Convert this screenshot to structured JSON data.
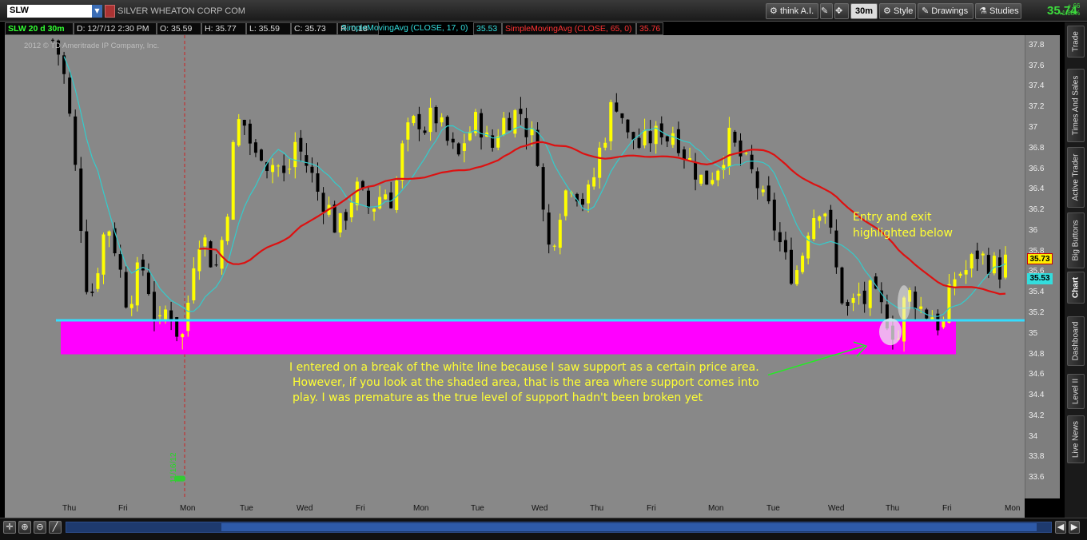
{
  "toolbar": {
    "symbol": "SLW",
    "company": "SILVER WHEATON CORP COM",
    "think_ai": "think A.I.",
    "interval": "30m",
    "style_label": "Style",
    "drawings_label": "Drawings",
    "studies_label": "Studies",
    "last_price": "35.74",
    "change": "+.66",
    "change_pct": "+1.88%"
  },
  "infobar": {
    "title": "SLW 20 d 30m",
    "date": "D: 12/7/12 2:30 PM",
    "open": "O: 35.59",
    "high": "H: 35.77",
    "low": "L: 35.59",
    "close": "C: 35.73",
    "range": "R: 0.18",
    "sma17_label": "SimpleMovingAvg (CLOSE, 17, 0)",
    "sma17_value": "35.53",
    "sma65_label": "SimpleMovingAvg (CLOSE, 65, 0)",
    "sma65_value": "35.76"
  },
  "chart": {
    "copyright": "2012 © TD Ameritrade IP Company, Inc.",
    "marker_label": "11/16/12",
    "annotation_entry": [
      "Entry and exit",
      "highlighted below"
    ],
    "annotation_main": [
      "I entered on a break of the white line because I saw support as a certain price area.",
      "However, if you look at the shaded area, that is the area where support comes into",
      "play. I was premature as the true level of support hadn't been broken yet"
    ],
    "price_tag_close": "35.73",
    "price_tag_sma": "35.53",
    "colors": {
      "background": "#888888",
      "bull_candle": "#ffff00",
      "bear_candle": "#000000",
      "sma17": "#33cccc",
      "sma65": "#dd1111",
      "support_line": "#33ddff",
      "shaded_zone": "#ff00ff",
      "annotation_text": "#ffff33"
    }
  },
  "chart_data": {
    "type": "candlestick",
    "title": "SLW 20 d 30m",
    "ylim": [
      33.4,
      37.9
    ],
    "y_ticks": [
      33.6,
      33.8,
      34,
      34.2,
      34.4,
      34.6,
      34.8,
      35,
      35.2,
      35.4,
      35.6,
      35.8,
      36,
      36.2,
      36.4,
      36.6,
      36.8,
      37,
      37.2,
      37.4,
      37.6,
      37.8
    ],
    "x_ticks": [
      "Thu",
      "Fri",
      "Mon",
      "Tue",
      "Wed",
      "Fri",
      "Mon",
      "Tue",
      "Wed",
      "Thu",
      "Fri",
      "Mon",
      "Tue",
      "Wed",
      "Thu",
      "Fri",
      "Mon"
    ],
    "support_line_price": 35.13,
    "shaded_zone_price": [
      34.8,
      35.13
    ],
    "series": [
      {
        "name": "SimpleMovingAvg (CLOSE, 17, 0)",
        "last": 35.53
      },
      {
        "name": "SimpleMovingAvg (CLOSE, 65, 0)",
        "last": 35.76
      }
    ],
    "close_path": [
      37.85,
      37.7,
      37.4,
      36.8,
      36.2,
      35.5,
      35.4,
      35.8,
      36.1,
      35.9,
      35.6,
      35.3,
      35.45,
      35.7,
      35.5,
      35.2,
      35.05,
      35.3,
      35.1,
      34.9,
      35.3,
      35.8,
      36.0,
      35.8,
      35.6,
      35.9,
      36.3,
      37.0,
      37.1,
      36.9,
      36.7,
      36.8,
      36.6,
      36.7,
      36.5,
      36.6,
      36.9,
      36.7,
      36.6,
      36.4,
      36.3,
      36.2,
      36.0,
      36.1,
      36.3,
      36.4,
      36.3,
      36.2,
      36.3,
      36.4,
      36.3,
      36.5,
      36.9,
      37.0,
      37.1,
      37.0,
      37.1,
      37.1,
      36.9,
      36.8,
      36.7,
      36.9,
      37.0,
      37.1,
      36.9,
      36.8,
      37.0,
      37.1,
      37.1,
      37.2,
      37.0,
      36.9,
      36.7,
      35.8,
      35.9,
      36.2,
      36.4,
      36.5,
      36.3,
      36.3,
      36.5,
      36.8,
      37.0,
      37.3,
      37.2,
      36.9,
      36.9,
      36.8,
      36.9,
      36.9,
      37.0,
      36.9,
      37.0,
      36.8,
      36.7,
      36.6,
      36.5,
      36.5,
      36.6,
      36.7,
      36.9,
      36.8,
      36.7,
      36.6,
      36.5,
      36.3,
      36.2,
      36.0,
      35.8,
      35.6,
      35.6,
      35.8,
      36.1,
      36.2,
      36.3,
      36.0,
      35.6,
      35.3,
      35.2,
      35.4,
      35.3,
      35.4,
      35.3,
      35.2,
      35.1,
      34.9,
      35.3,
      35.4,
      35.3,
      35.2,
      35.2,
      35.1,
      35.1,
      35.5,
      35.6,
      35.6,
      35.7,
      35.8,
      35.7,
      35.7,
      35.6,
      35.7
    ]
  }
}
